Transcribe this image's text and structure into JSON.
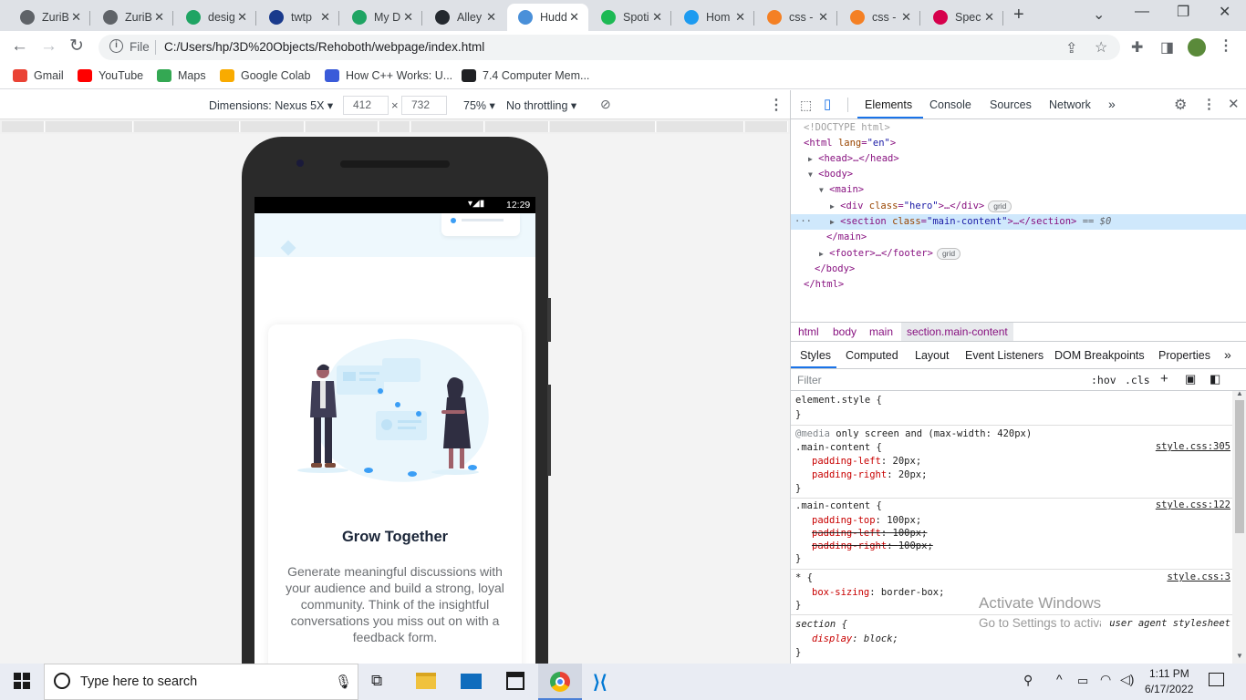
{
  "tabs": [
    {
      "title": "ZuriB",
      "icon": "globe-icon",
      "color": "#5f6368"
    },
    {
      "title": "ZuriB",
      "icon": "globe-icon",
      "color": "#5f6368"
    },
    {
      "title": "desig",
      "icon": "drive-icon",
      "color": "#1fa463"
    },
    {
      "title": "twtp",
      "icon": "repl-icon",
      "color": "#1a3a8c"
    },
    {
      "title": "My D",
      "icon": "drive-icon",
      "color": "#1fa463"
    },
    {
      "title": "Alley",
      "icon": "github-icon",
      "color": "#24292f"
    },
    {
      "title": "Hudd",
      "icon": "huddle-icon",
      "color": "#4a90d9"
    },
    {
      "title": "Spoti",
      "icon": "spotify-icon",
      "color": "#1db954"
    },
    {
      "title": "Hom",
      "icon": "twitter-icon",
      "color": "#1d9bf0"
    },
    {
      "title": "css -",
      "icon": "stackoverflow-icon",
      "color": "#f48024"
    },
    {
      "title": "css -",
      "icon": "stackoverflow-icon",
      "color": "#f48024"
    },
    {
      "title": "Spec",
      "icon": "specs-icon",
      "color": "#d6004c"
    }
  ],
  "active_tab_index": 6,
  "omnibox": {
    "scheme_label": "File",
    "url": "C:/Users/hp/3D%20Objects/Rehoboth/webpage/index.html"
  },
  "bookmarks": [
    {
      "label": "Gmail",
      "icon": "gmail-icon",
      "color": "#ea4335"
    },
    {
      "label": "YouTube",
      "icon": "youtube-icon",
      "color": "#ff0000"
    },
    {
      "label": "Maps",
      "icon": "maps-icon",
      "color": "#34a853"
    },
    {
      "label": "Google Colab",
      "icon": "colab-icon",
      "color": "#f9ab00"
    },
    {
      "label": "How C++ Works: U...",
      "icon": "bookmark-icon",
      "color": "#3a5bd9"
    },
    {
      "label": "7.4 Computer Mem...",
      "icon": "wiki-icon",
      "color": "#202124"
    }
  ],
  "device_toolbar": {
    "dimensions_label": "Dimensions: Nexus 5X",
    "width": "412",
    "height": "732",
    "times": "×",
    "zoom": "75%",
    "throttling": "No throttling"
  },
  "phone": {
    "time": "12:29",
    "card_title": "Grow Together",
    "card_text": "Generate meaningful discussions with your audience and build a strong, loyal community. Think of the insightful conversations you miss out on with a feedback form."
  },
  "devtools": {
    "tabs": [
      "Elements",
      "Console",
      "Sources",
      "Network"
    ],
    "more": "»",
    "dom": {
      "doctype": "<!DOCTYPE html>",
      "html_open": "<html",
      "lang_attr": "lang",
      "lang_val": "\"en\"",
      "html_close_br": ">",
      "head": "<head>…</head>",
      "body_open": "<body>",
      "main_open": "<main>",
      "div_open": "<div",
      "class_attr": "class",
      "hero_val": "\"hero\"",
      "div_rest": ">…</div>",
      "section_open": "<section",
      "main_content_val": "\"main-content\"",
      "section_rest": ">…</section>",
      "selected_marker": "== $0",
      "dots": "···",
      "main_close": "</main>",
      "footer": "<footer>…</footer>",
      "body_close": "</body>",
      "html_close": "</html>",
      "grid_badge": "grid"
    },
    "breadcrumbs": [
      "html",
      "body",
      "main",
      "section.main-content"
    ],
    "style_tabs": [
      "Styles",
      "Computed",
      "Layout",
      "Event Listeners",
      "DOM Breakpoints",
      "Properties"
    ],
    "filter_placeholder": "Filter",
    "hov": ":hov",
    "cls": ".cls",
    "styles": {
      "element_style": "element.style {",
      "close_brace": "}",
      "media": "@media",
      "media_rest": "only screen and (max-width: 420px)",
      "rule1_selector": ".main-content {",
      "rule1_source": "style.css:305",
      "padding_left": "padding-left",
      "padding_right": "padding-right",
      "padding_top": "padding-top",
      "v20": "20px",
      "v100": "100px",
      "rule2_selector": ".main-content {",
      "rule2_source": "style.css:122",
      "rule3_selector": "* {",
      "rule3_source": "style.css:3",
      "box_sizing": "box-sizing",
      "border_box": "border-box",
      "rule4_selector": "section {",
      "rule4_source": "user agent stylesheet",
      "display": "display",
      "block": "block"
    }
  },
  "activate_windows": {
    "title": "Activate Windows",
    "subtitle": "Go to Settings to activate Windows."
  },
  "taskbar": {
    "search_placeholder": "Type here to search",
    "time": "1:11 PM",
    "date": "6/17/2022"
  }
}
